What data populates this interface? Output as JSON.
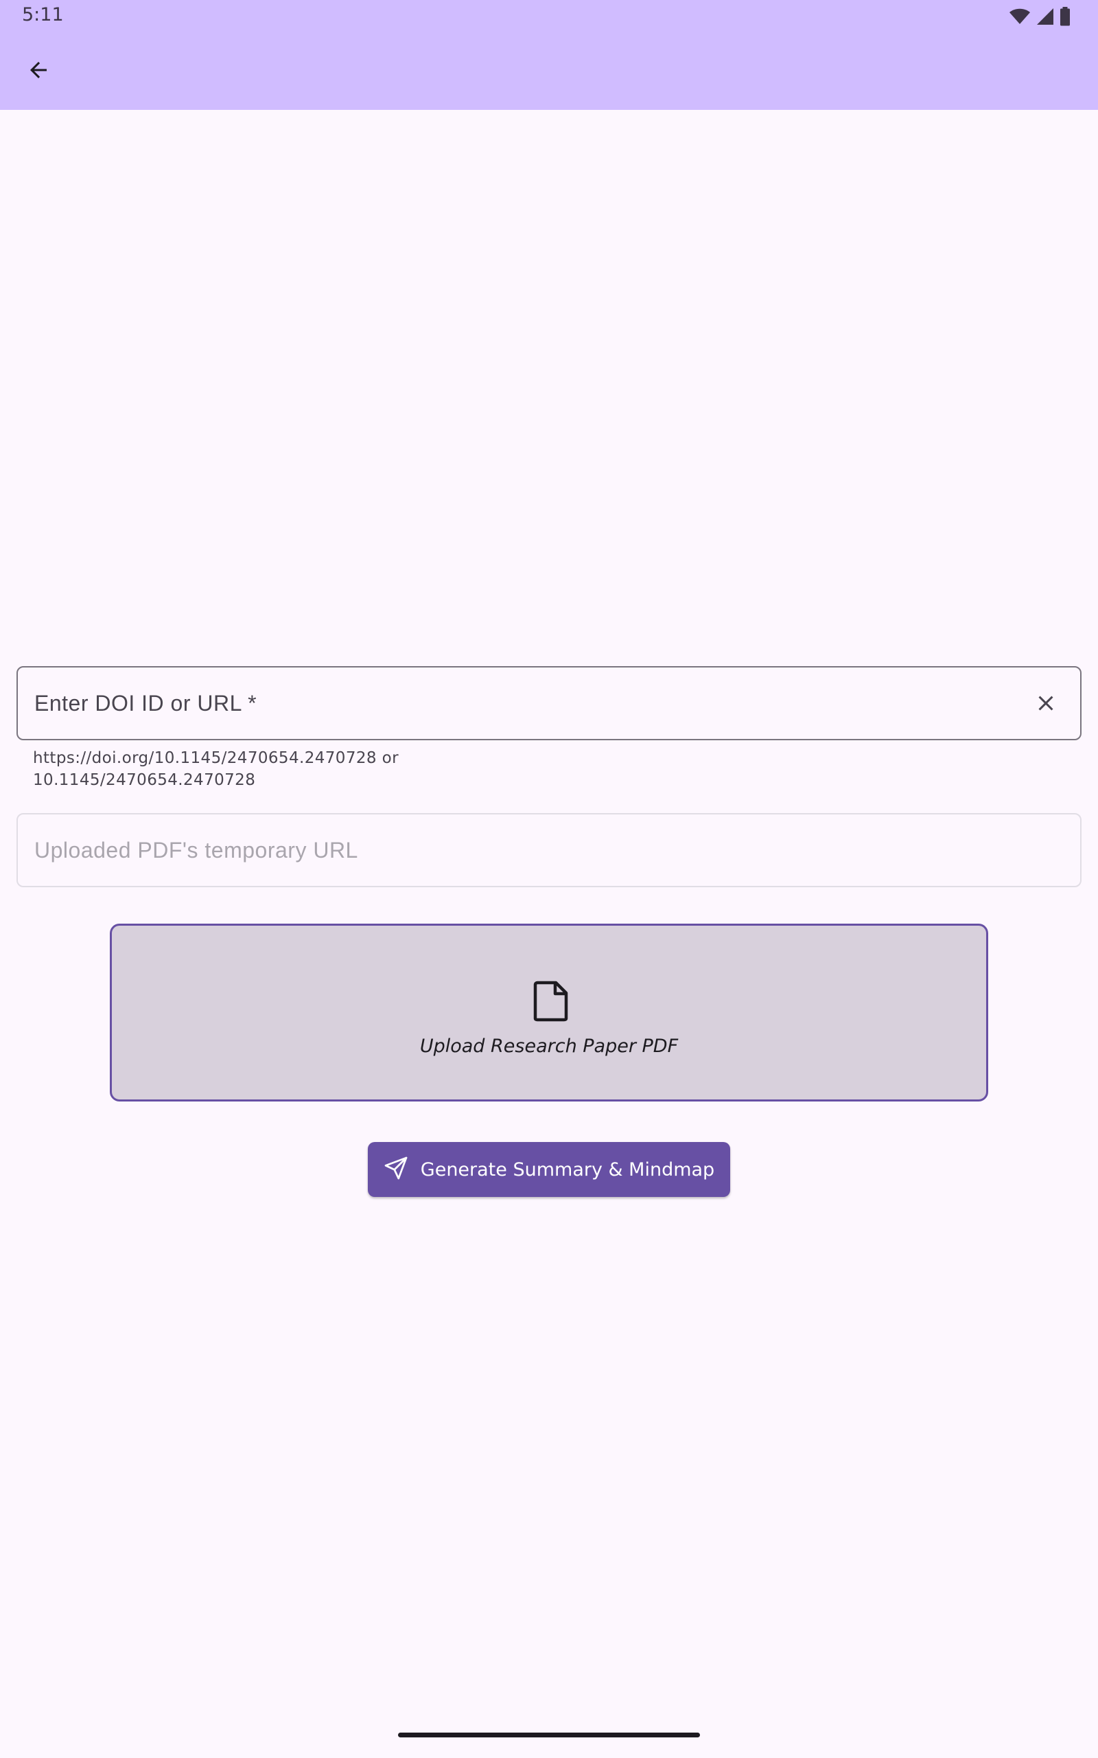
{
  "status_bar": {
    "time": "5:11",
    "icons": [
      "wifi-icon",
      "cellular-signal-icon",
      "battery-icon"
    ]
  },
  "app_bar": {
    "back_icon": "arrow-left-icon",
    "background_color": "#d0bcff"
  },
  "doi_input": {
    "placeholder": "Enter DOI ID or URL *",
    "value": "",
    "clear_icon": "close-icon",
    "helper_text": "https://doi.org/10.1145/2470654.2470728 or 10.1145/2470654.2470728"
  },
  "pdf_url_input": {
    "placeholder": "Uploaded PDF's temporary URL",
    "value": ""
  },
  "upload": {
    "icon": "document-icon",
    "label": "Upload Research Paper PDF"
  },
  "generate_button": {
    "icon": "send-icon",
    "label": "Generate Summary & Mindmap"
  },
  "colors": {
    "primary": "#6750a4",
    "background": "#fdf7fe",
    "upload_box": "#d8d0dc"
  }
}
